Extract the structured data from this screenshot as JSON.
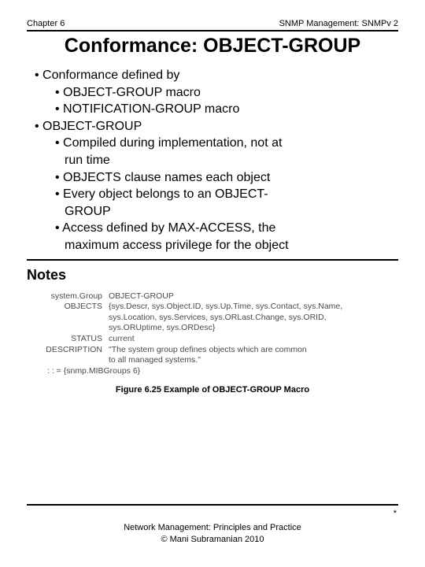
{
  "header": {
    "left": "Chapter 6",
    "right": "SNMP Management: SNMPv 2"
  },
  "title": "Conformance: OBJECT-GROUP",
  "bullets": {
    "b1": "• Conformance defined by",
    "b1a": "• OBJECT-GROUP macro",
    "b1b": "• NOTIFICATION-GROUP macro",
    "b2": "• OBJECT-GROUP",
    "b2a": "• Compiled during implementation, not at",
    "b2a_cont": "run time",
    "b2b": "• OBJECTS clause names each object",
    "b2c": "• Every object belongs to an OBJECT-",
    "b2c_cont": "GROUP",
    "b2d": "• Access defined by MAX-ACCESS, the",
    "b2d_cont": "maximum access privilege for the object"
  },
  "notes_heading": "Notes",
  "macro": {
    "row1_label": "system.Group",
    "row1_val": "OBJECT-GROUP",
    "row2_label": "OBJECTS",
    "row2_val": "{sys.Descr, sys.Object.ID, sys.Up.Time, sys.Contact, sys.Name,",
    "row2_val2": "sys.Location, sys.Services, sys.ORLast.Change, sys.ORID,",
    "row2_val3": "sys.ORUptime, sys.ORDesc}",
    "row3_label": "STATUS",
    "row3_val": "current",
    "row4_label": "DESCRIPTION",
    "row4_val": "\"The system group defines objects which are common",
    "row4_val2": "to all managed systems.\"",
    "row5": ": : = {snmp.MIBGroups 6}"
  },
  "figure_caption": "Figure 6.25  Example of OBJECT-GROUP Macro",
  "footer": {
    "line1": "Network Management: Principles and Practice",
    "line2": "©  Mani Subramanian 2010"
  },
  "star": "*"
}
